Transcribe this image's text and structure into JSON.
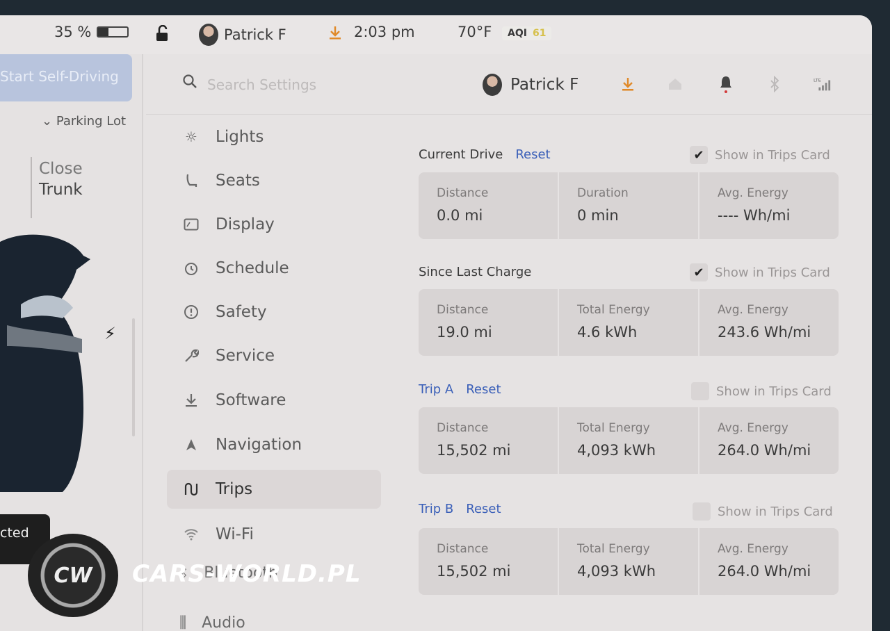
{
  "status": {
    "battery_pct": "35 %",
    "battery_level": 0.35,
    "user_name": "Patrick F",
    "time": "2:03 pm",
    "temperature": "70°F",
    "aqi_label": "AQI",
    "aqi_value": "61"
  },
  "car_panel": {
    "fsd_label": "Start Self-Driving",
    "location": "Parking Lot",
    "trunk_line1": "Close",
    "trunk_line2": "Trunk",
    "connected_label": "cted"
  },
  "header": {
    "search_placeholder": "Search Settings",
    "user_name": "Patrick F"
  },
  "menu": [
    {
      "label": "Lights",
      "icon": "sun-icon"
    },
    {
      "label": "Seats",
      "icon": "seat-icon"
    },
    {
      "label": "Display",
      "icon": "display-icon"
    },
    {
      "label": "Schedule",
      "icon": "alarm-clock-icon"
    },
    {
      "label": "Safety",
      "icon": "alert-circle-icon"
    },
    {
      "label": "Service",
      "icon": "wrench-icon"
    },
    {
      "label": "Software",
      "icon": "download-icon"
    },
    {
      "label": "Navigation",
      "icon": "navigation-arrow-icon"
    },
    {
      "label": "Trips",
      "icon": "trips-icon"
    },
    {
      "label": "Wi-Fi",
      "icon": "wifi-icon"
    }
  ],
  "menu_below": {
    "bluetooth": "Bluetooth",
    "audio": "Audio"
  },
  "trips": {
    "current_drive": {
      "title": "Current Drive",
      "reset": "Reset",
      "show_label": "Show in Trips Card",
      "checked": true,
      "cells": [
        {
          "label": "Distance",
          "value": "0.0 mi"
        },
        {
          "label": "Duration",
          "value": "0 min"
        },
        {
          "label": "Avg. Energy",
          "value": "---- Wh/mi"
        }
      ]
    },
    "since_last_charge": {
      "title": "Since Last Charge",
      "show_label": "Show in Trips Card",
      "checked": true,
      "cells": [
        {
          "label": "Distance",
          "value": "19.0 mi"
        },
        {
          "label": "Total Energy",
          "value": "4.6 kWh"
        },
        {
          "label": "Avg. Energy",
          "value": "243.6 Wh/mi"
        }
      ]
    },
    "trip_a": {
      "title": "Trip A",
      "reset": "Reset",
      "show_label": "Show in Trips Card",
      "checked": false,
      "cells": [
        {
          "label": "Distance",
          "value": "15,502 mi"
        },
        {
          "label": "Total Energy",
          "value": "4,093 kWh"
        },
        {
          "label": "Avg. Energy",
          "value": "264.0 Wh/mi"
        }
      ]
    },
    "trip_b": {
      "title": "Trip B",
      "reset": "Reset",
      "show_label": "Show in Trips Card",
      "checked": false,
      "cells": [
        {
          "label": "Distance",
          "value": "15,502 mi"
        },
        {
          "label": "Total Energy",
          "value": "4,093 kWh"
        },
        {
          "label": "Avg. Energy",
          "value": "264.0 Wh/mi"
        }
      ]
    }
  },
  "watermark": {
    "logo_text": "CW",
    "text": "CARS-WORLD.PL"
  },
  "colors": {
    "accent_blue": "#3a5fb8",
    "download_orange": "#e08a2a",
    "screen_bg": "#e6e3e3",
    "card_bg": "#d8d4d4"
  }
}
